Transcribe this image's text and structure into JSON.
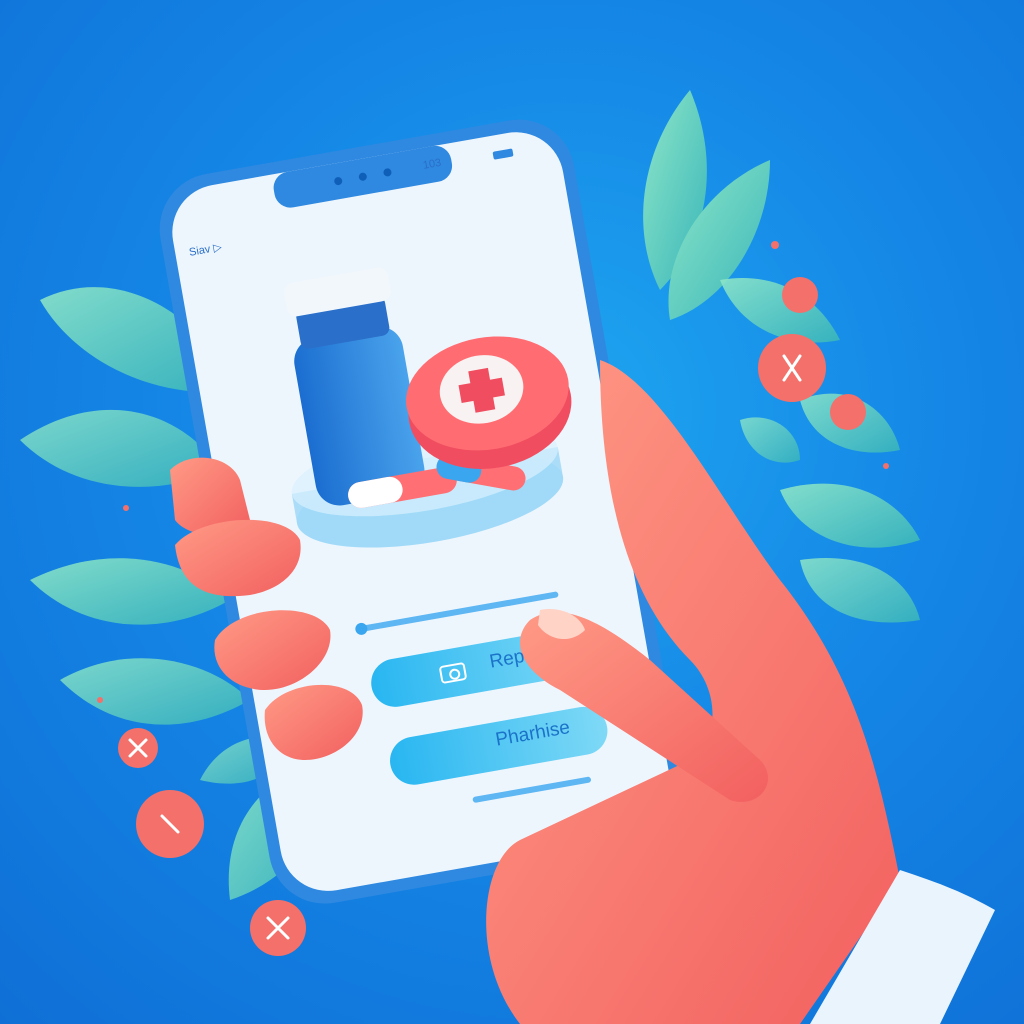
{
  "phone": {
    "status_left": "Siav ▷",
    "status_right": "103"
  },
  "screen": {
    "primary_button_label": "Rep",
    "secondary_button_label": "Pharhise"
  },
  "colors": {
    "background": "#1587e6",
    "screen": "#eef6fd",
    "accent_blue": "#1fb3ee",
    "coral": "#f4706a",
    "leaf": "#5fd3b5"
  },
  "icons": [
    "medical-cross-icon",
    "camera-icon",
    "close-icon"
  ]
}
